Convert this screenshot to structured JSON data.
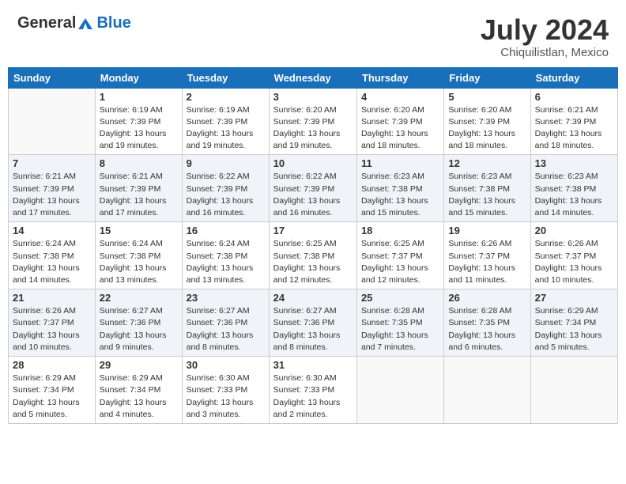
{
  "header": {
    "logo_general": "General",
    "logo_blue": "Blue",
    "month": "July 2024",
    "location": "Chiquilistlan, Mexico"
  },
  "weekdays": [
    "Sunday",
    "Monday",
    "Tuesday",
    "Wednesday",
    "Thursday",
    "Friday",
    "Saturday"
  ],
  "rows": [
    [
      {
        "day": "",
        "info": ""
      },
      {
        "day": "1",
        "info": "Sunrise: 6:19 AM\nSunset: 7:39 PM\nDaylight: 13 hours\nand 19 minutes."
      },
      {
        "day": "2",
        "info": "Sunrise: 6:19 AM\nSunset: 7:39 PM\nDaylight: 13 hours\nand 19 minutes."
      },
      {
        "day": "3",
        "info": "Sunrise: 6:20 AM\nSunset: 7:39 PM\nDaylight: 13 hours\nand 19 minutes."
      },
      {
        "day": "4",
        "info": "Sunrise: 6:20 AM\nSunset: 7:39 PM\nDaylight: 13 hours\nand 18 minutes."
      },
      {
        "day": "5",
        "info": "Sunrise: 6:20 AM\nSunset: 7:39 PM\nDaylight: 13 hours\nand 18 minutes."
      },
      {
        "day": "6",
        "info": "Sunrise: 6:21 AM\nSunset: 7:39 PM\nDaylight: 13 hours\nand 18 minutes."
      }
    ],
    [
      {
        "day": "7",
        "info": "Sunrise: 6:21 AM\nSunset: 7:39 PM\nDaylight: 13 hours\nand 17 minutes."
      },
      {
        "day": "8",
        "info": "Sunrise: 6:21 AM\nSunset: 7:39 PM\nDaylight: 13 hours\nand 17 minutes."
      },
      {
        "day": "9",
        "info": "Sunrise: 6:22 AM\nSunset: 7:39 PM\nDaylight: 13 hours\nand 16 minutes."
      },
      {
        "day": "10",
        "info": "Sunrise: 6:22 AM\nSunset: 7:39 PM\nDaylight: 13 hours\nand 16 minutes."
      },
      {
        "day": "11",
        "info": "Sunrise: 6:23 AM\nSunset: 7:38 PM\nDaylight: 13 hours\nand 15 minutes."
      },
      {
        "day": "12",
        "info": "Sunrise: 6:23 AM\nSunset: 7:38 PM\nDaylight: 13 hours\nand 15 minutes."
      },
      {
        "day": "13",
        "info": "Sunrise: 6:23 AM\nSunset: 7:38 PM\nDaylight: 13 hours\nand 14 minutes."
      }
    ],
    [
      {
        "day": "14",
        "info": "Sunrise: 6:24 AM\nSunset: 7:38 PM\nDaylight: 13 hours\nand 14 minutes."
      },
      {
        "day": "15",
        "info": "Sunrise: 6:24 AM\nSunset: 7:38 PM\nDaylight: 13 hours\nand 13 minutes."
      },
      {
        "day": "16",
        "info": "Sunrise: 6:24 AM\nSunset: 7:38 PM\nDaylight: 13 hours\nand 13 minutes."
      },
      {
        "day": "17",
        "info": "Sunrise: 6:25 AM\nSunset: 7:38 PM\nDaylight: 13 hours\nand 12 minutes."
      },
      {
        "day": "18",
        "info": "Sunrise: 6:25 AM\nSunset: 7:37 PM\nDaylight: 13 hours\nand 12 minutes."
      },
      {
        "day": "19",
        "info": "Sunrise: 6:26 AM\nSunset: 7:37 PM\nDaylight: 13 hours\nand 11 minutes."
      },
      {
        "day": "20",
        "info": "Sunrise: 6:26 AM\nSunset: 7:37 PM\nDaylight: 13 hours\nand 10 minutes."
      }
    ],
    [
      {
        "day": "21",
        "info": "Sunrise: 6:26 AM\nSunset: 7:37 PM\nDaylight: 13 hours\nand 10 minutes."
      },
      {
        "day": "22",
        "info": "Sunrise: 6:27 AM\nSunset: 7:36 PM\nDaylight: 13 hours\nand 9 minutes."
      },
      {
        "day": "23",
        "info": "Sunrise: 6:27 AM\nSunset: 7:36 PM\nDaylight: 13 hours\nand 8 minutes."
      },
      {
        "day": "24",
        "info": "Sunrise: 6:27 AM\nSunset: 7:36 PM\nDaylight: 13 hours\nand 8 minutes."
      },
      {
        "day": "25",
        "info": "Sunrise: 6:28 AM\nSunset: 7:35 PM\nDaylight: 13 hours\nand 7 minutes."
      },
      {
        "day": "26",
        "info": "Sunrise: 6:28 AM\nSunset: 7:35 PM\nDaylight: 13 hours\nand 6 minutes."
      },
      {
        "day": "27",
        "info": "Sunrise: 6:29 AM\nSunset: 7:34 PM\nDaylight: 13 hours\nand 5 minutes."
      }
    ],
    [
      {
        "day": "28",
        "info": "Sunrise: 6:29 AM\nSunset: 7:34 PM\nDaylight: 13 hours\nand 5 minutes."
      },
      {
        "day": "29",
        "info": "Sunrise: 6:29 AM\nSunset: 7:34 PM\nDaylight: 13 hours\nand 4 minutes."
      },
      {
        "day": "30",
        "info": "Sunrise: 6:30 AM\nSunset: 7:33 PM\nDaylight: 13 hours\nand 3 minutes."
      },
      {
        "day": "31",
        "info": "Sunrise: 6:30 AM\nSunset: 7:33 PM\nDaylight: 13 hours\nand 2 minutes."
      },
      {
        "day": "",
        "info": ""
      },
      {
        "day": "",
        "info": ""
      },
      {
        "day": "",
        "info": ""
      }
    ]
  ]
}
